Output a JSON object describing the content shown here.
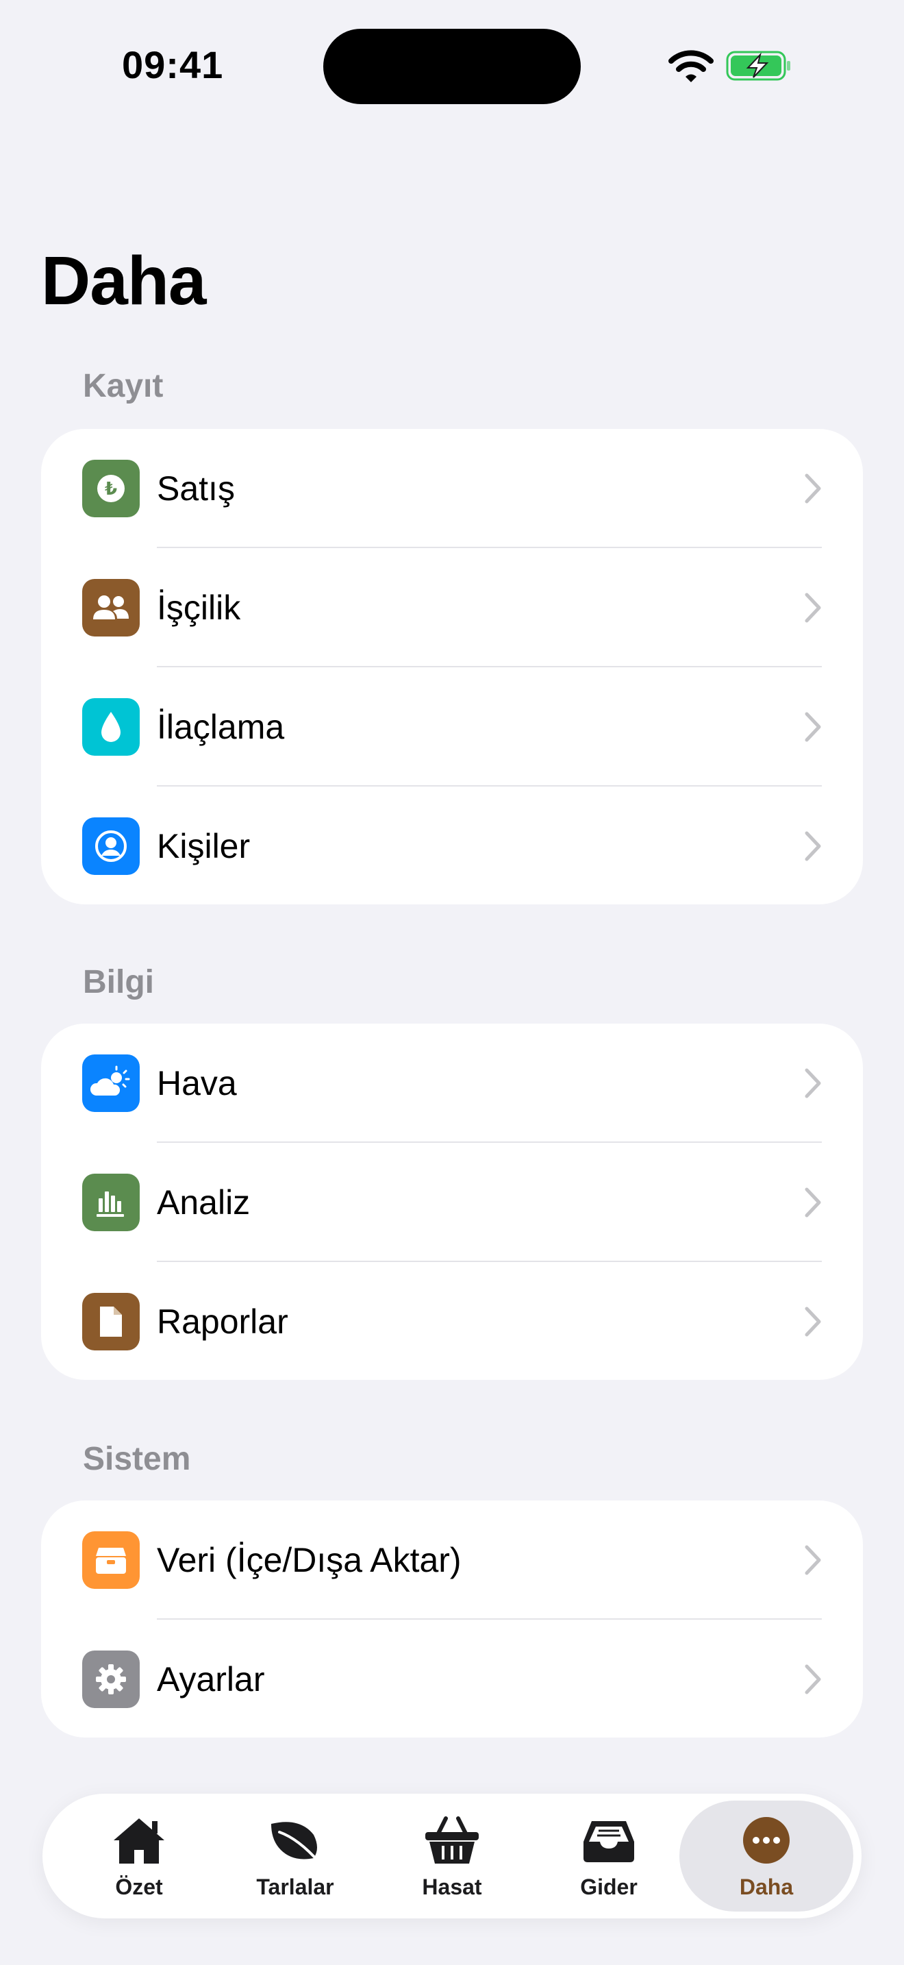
{
  "status_bar": {
    "time": "09:41"
  },
  "page": {
    "title": "Daha"
  },
  "sections": [
    {
      "header": "Kayıt",
      "items": [
        {
          "label": "Satış",
          "icon": "lira-icon",
          "color": "#5b8c4f"
        },
        {
          "label": "İşçilik",
          "icon": "people-icon",
          "color": "#8b5a2b"
        },
        {
          "label": "İlaçlama",
          "icon": "drop-icon",
          "color": "#00c4d4"
        },
        {
          "label": "Kişiler",
          "icon": "person-circle-icon",
          "color": "#0a84ff"
        }
      ]
    },
    {
      "header": "Bilgi",
      "items": [
        {
          "label": "Hava",
          "icon": "cloud-sun-icon",
          "color": "#0a84ff"
        },
        {
          "label": "Analiz",
          "icon": "chart-icon",
          "color": "#5b8c4f"
        },
        {
          "label": "Raporlar",
          "icon": "document-icon",
          "color": "#8b5a2b"
        }
      ]
    },
    {
      "header": "Sistem",
      "items": [
        {
          "label": "Veri (İçe/Dışa Aktar)",
          "icon": "archive-icon",
          "color": "#ff9533"
        },
        {
          "label": "Ayarlar",
          "icon": "gear-icon",
          "color": "#8e8e93"
        }
      ]
    }
  ],
  "tabbar": {
    "tabs": [
      {
        "label": "Özet",
        "icon": "house-icon"
      },
      {
        "label": "Tarlalar",
        "icon": "leaf-icon"
      },
      {
        "label": "Hasat",
        "icon": "basket-icon"
      },
      {
        "label": "Gider",
        "icon": "tray-icon"
      },
      {
        "label": "Daha",
        "icon": "ellipsis-circle-icon",
        "active": true
      }
    ],
    "accent_color": "#7a4d22"
  }
}
